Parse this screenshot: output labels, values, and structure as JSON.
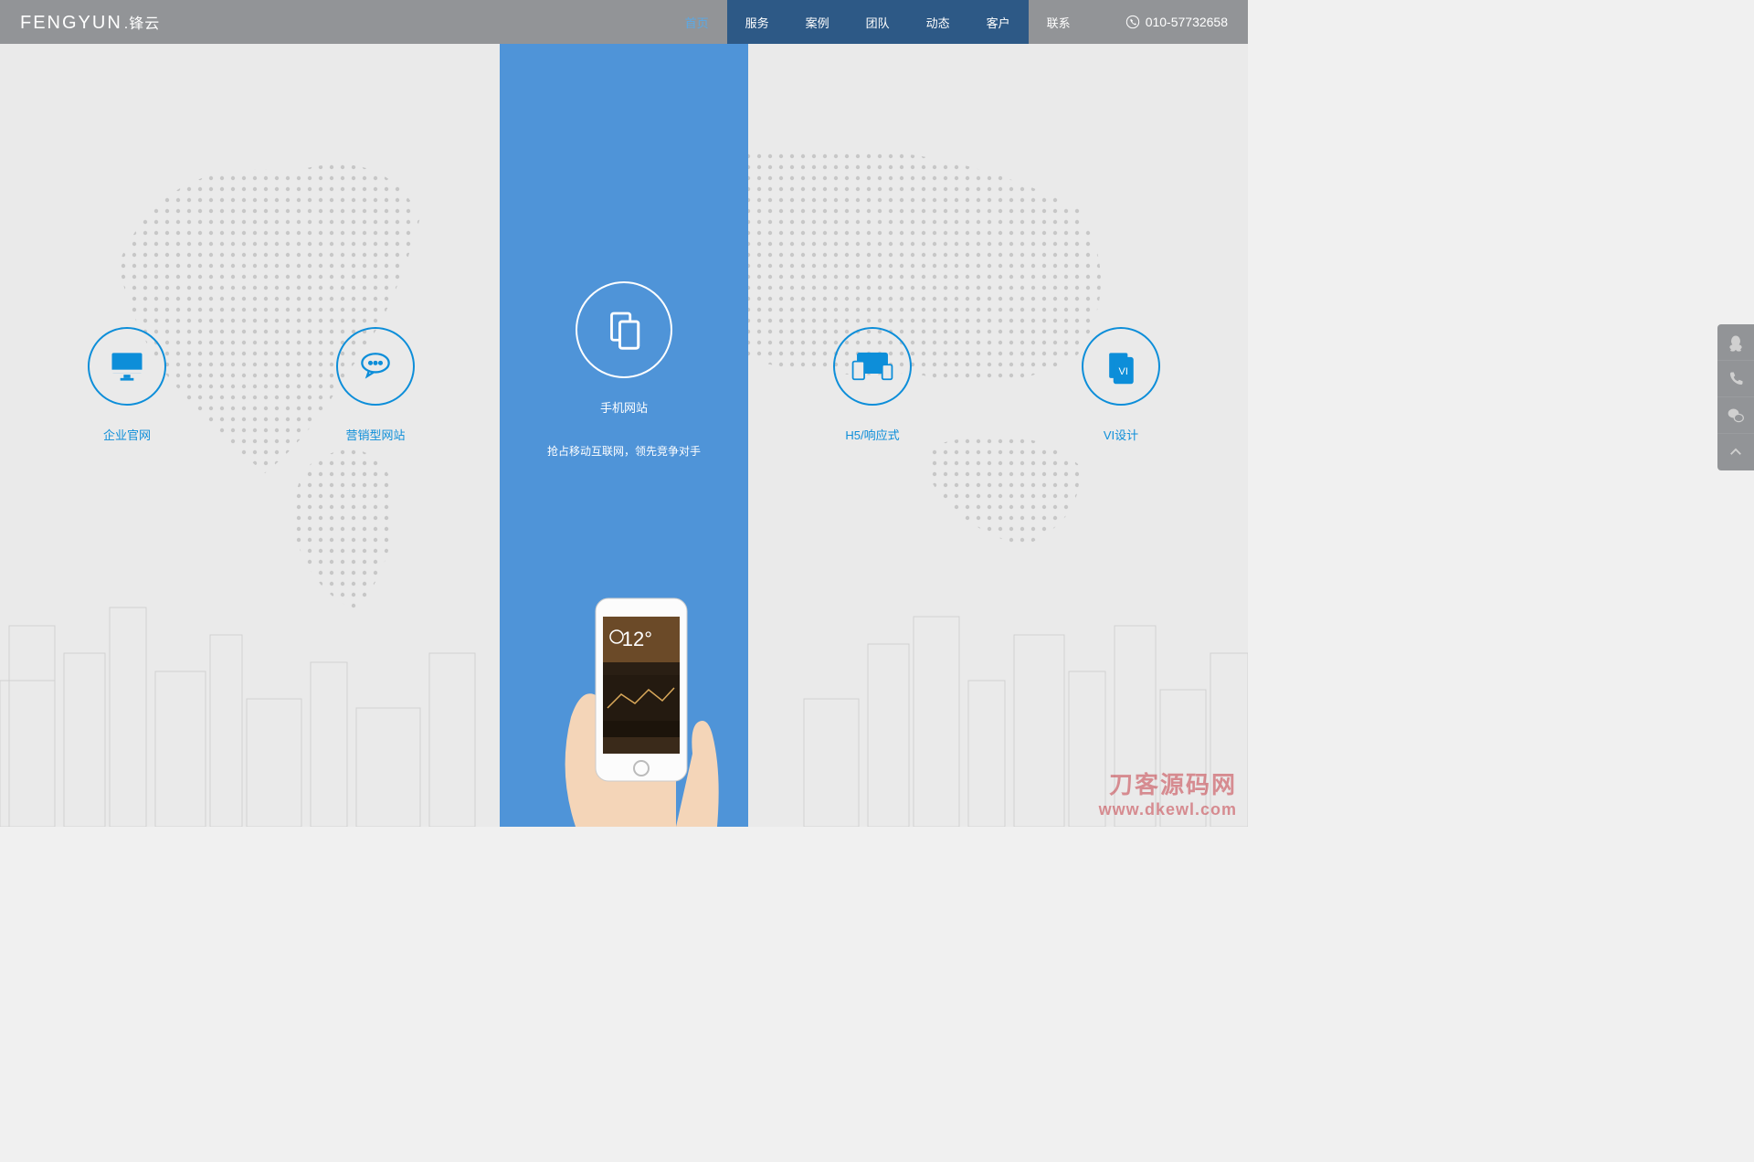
{
  "brand": {
    "en": "FENGYUN",
    "cn": "锋云"
  },
  "nav": {
    "items": [
      {
        "label": "首页",
        "active": true,
        "dark": false
      },
      {
        "label": "服务",
        "active": false,
        "dark": true
      },
      {
        "label": "案例",
        "active": false,
        "dark": true
      },
      {
        "label": "团队",
        "active": false,
        "dark": true
      },
      {
        "label": "动态",
        "active": false,
        "dark": true
      },
      {
        "label": "客户",
        "active": false,
        "dark": true
      },
      {
        "label": "联系",
        "active": false,
        "dark": false
      }
    ]
  },
  "phone": "010-57732658",
  "services": [
    {
      "icon": "monitor-icon",
      "label": "企业官网"
    },
    {
      "icon": "chat-icon",
      "label": "营销型网站"
    },
    {
      "icon": "mobile-icon",
      "label": "手机网站",
      "sub": "抢占移动互联网，领先竞争对手"
    },
    {
      "icon": "responsive-icon",
      "label": "H5/响应式"
    },
    {
      "icon": "vi-icon",
      "label": "VI设计"
    }
  ],
  "side_tools": [
    {
      "icon": "qq-icon"
    },
    {
      "icon": "phone-icon"
    },
    {
      "icon": "wechat-icon"
    },
    {
      "icon": "top-icon"
    }
  ],
  "watermark": {
    "line1": "刀客源码网",
    "line2": "www.dkewl.com"
  },
  "colors": {
    "accent": "#0d8ed9",
    "band": "#4f94d8",
    "header": "#929497"
  }
}
